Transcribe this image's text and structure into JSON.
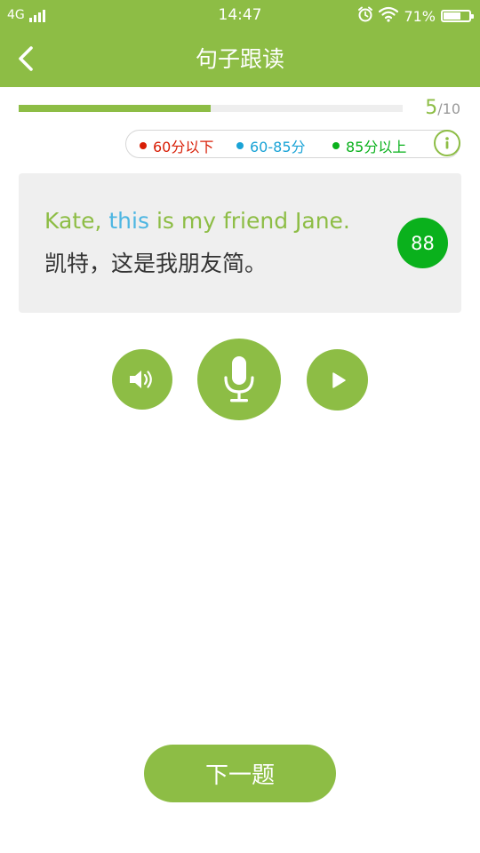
{
  "status_bar": {
    "network": "4G",
    "time": "14:47",
    "battery_percent": "71%",
    "battery_level": 0.71,
    "icons": [
      "signal-icon",
      "alarm-icon",
      "wifi-icon",
      "battery-icon"
    ]
  },
  "header": {
    "title": "句子跟读",
    "back_icon": "chevron-left-icon"
  },
  "progress": {
    "current": "5",
    "total": "/10",
    "fraction": 0.5
  },
  "legend": {
    "items": [
      {
        "label": "60分以下",
        "color": "#d81e06"
      },
      {
        "label": "60-85分",
        "color": "#1aa3d6"
      },
      {
        "label": "85分以上",
        "color": "#0ab11c"
      }
    ],
    "info_icon": "info-icon"
  },
  "sentence": {
    "english_parts": [
      {
        "text": "Kate,",
        "color": "#8dbd45"
      },
      {
        "text": "this",
        "color": "#4db6e2"
      },
      {
        "text": "is my friend Jane.",
        "color": "#8dbd45"
      }
    ],
    "chinese": "凯特，这是我朋友简。",
    "score": "88",
    "score_color": "#0ab11c"
  },
  "controls": {
    "speaker_icon": "speaker-icon",
    "mic_icon": "microphone-icon",
    "play_icon": "play-icon"
  },
  "footer": {
    "next_label": "下一题"
  },
  "colors": {
    "accent": "#8dbd45",
    "card_bg": "#efefef"
  }
}
